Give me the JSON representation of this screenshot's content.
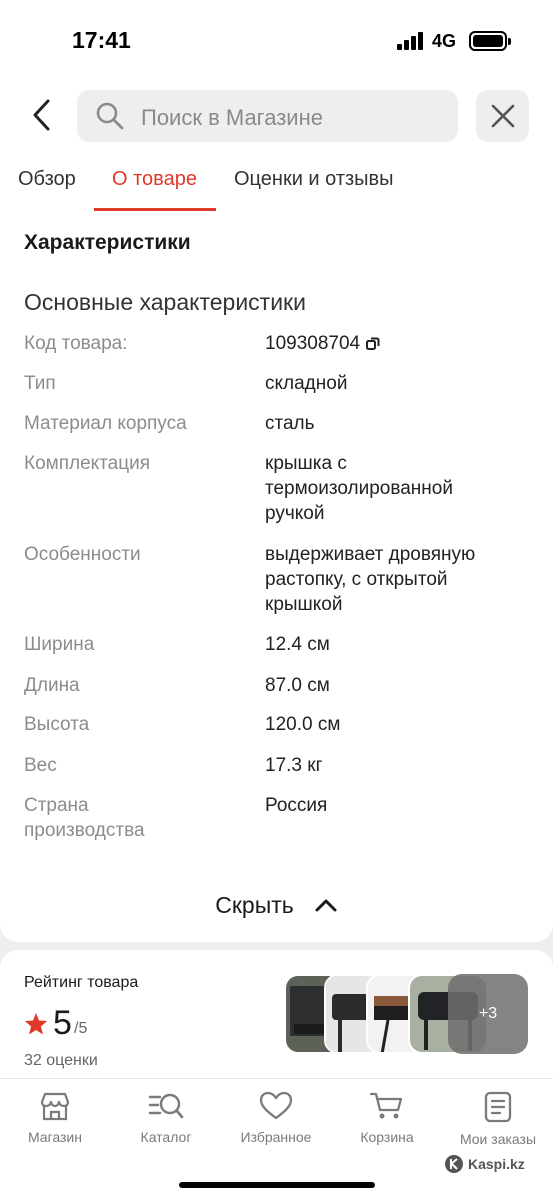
{
  "status_bar": {
    "time": "17:41",
    "network": "4G"
  },
  "header": {
    "search_placeholder": "Поиск в Магазине",
    "tabs": [
      {
        "label": "Обзор",
        "active": false
      },
      {
        "label": "О товаре",
        "active": true
      },
      {
        "label": "Оценки и отзывы",
        "active": false
      }
    ]
  },
  "specs": {
    "section_title": "Характеристики",
    "group_title": "Основные характеристики",
    "rows": [
      {
        "label": "Код товара:",
        "value": "109308704"
      },
      {
        "label": "Тип",
        "value": "складной"
      },
      {
        "label": "Материал корпуса",
        "value": "сталь"
      },
      {
        "label": "Комплектация",
        "value": "крышка с термоизолированной ручкой"
      },
      {
        "label": "Особенности",
        "value": "выдерживает дровяную растопку, с открытой крышкой"
      },
      {
        "label": "Ширина",
        "value": "12.4 см"
      },
      {
        "label": "Длина",
        "value": "87.0 см"
      },
      {
        "label": "Высота",
        "value": "120.0 см"
      },
      {
        "label": "Вес",
        "value": "17.3 кг"
      },
      {
        "label": "Страна производства",
        "value": "Россия"
      }
    ],
    "hide_label": "Скрыть"
  },
  "rating": {
    "title": "Рейтинг товара",
    "value": "5",
    "max": "/5",
    "count": "32 оценки",
    "more_photos": "+3"
  },
  "bottom_nav": [
    {
      "label": "Магазин",
      "icon": "store-icon"
    },
    {
      "label": "Каталог",
      "icon": "catalog-search-icon"
    },
    {
      "label": "Избранное",
      "icon": "heart-icon"
    },
    {
      "label": "Корзина",
      "icon": "cart-icon"
    },
    {
      "label": "Мои заказы",
      "icon": "orders-icon"
    }
  ],
  "watermark": "Kaspi.kz",
  "colors": {
    "accent": "#e0382a",
    "background": "#eeeeef",
    "star": "#e0382a"
  }
}
